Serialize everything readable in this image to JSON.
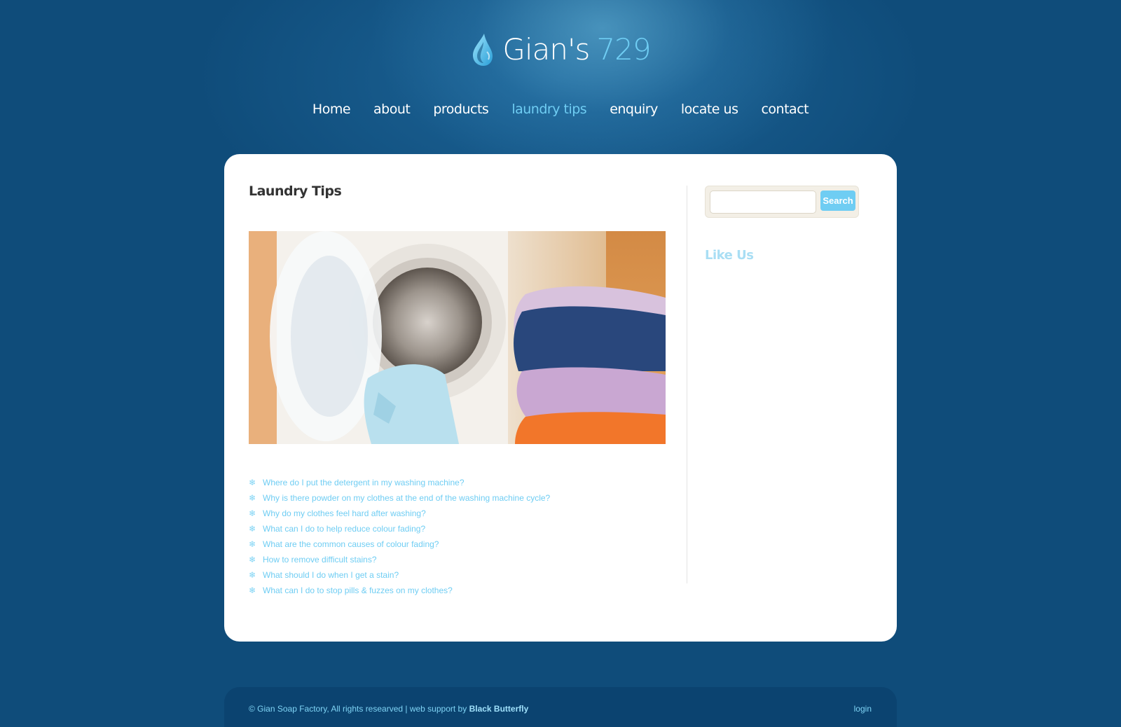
{
  "brand": {
    "name": "Gian's",
    "number": "729",
    "accent_color": "#6fcdf3",
    "background_color": "#0f4c7a"
  },
  "nav": {
    "items": [
      {
        "label": "Home",
        "active": false
      },
      {
        "label": "about",
        "active": false
      },
      {
        "label": "products",
        "active": false
      },
      {
        "label": "laundry tips",
        "active": true
      },
      {
        "label": "enquiry",
        "active": false
      },
      {
        "label": "locate us",
        "active": false
      },
      {
        "label": "contact",
        "active": false
      }
    ]
  },
  "main": {
    "title": "Laundry Tips",
    "faq": [
      "Where do I put the detergent in my washing machine?",
      "Why is there powder on my clothes at the end of the washing machine cycle?",
      "Why do my clothes feel hard after washing?",
      "What can I do to help reduce colour fading?",
      "What are the common causes of colour fading?",
      "How to remove difficult stains?",
      "What should I do when I get a stain?",
      "What can I do to stop pills & fuzzes on my clothes?"
    ]
  },
  "sidebar": {
    "search": {
      "value": "",
      "button_label": "Search"
    },
    "like_us_title": "Like Us"
  },
  "footer": {
    "copyright": "© Gian Soap Factory, All rights researved | web support by ",
    "credit": "Black Butterfly",
    "login": "login"
  },
  "icons": {
    "logo": "water-drop-icon",
    "faq_bullet": "snowflake-bullet-icon"
  }
}
